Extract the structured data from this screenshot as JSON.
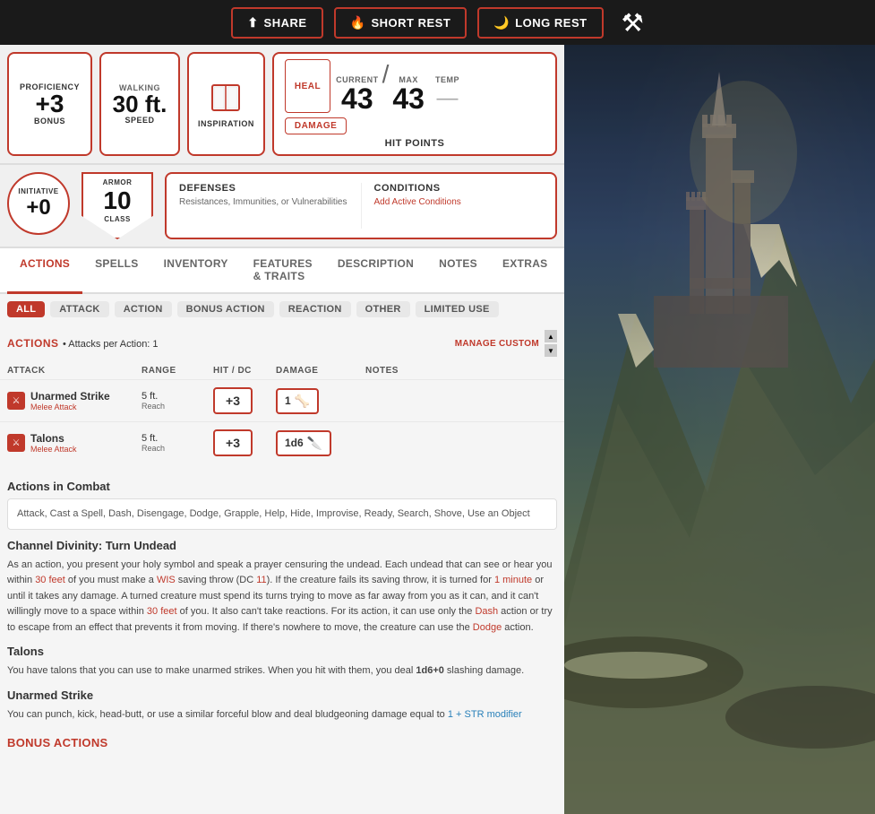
{
  "topBar": {
    "shareLabel": "SHARE",
    "shortRestLabel": "SHORT REST",
    "longRestLabel": "LONG REST"
  },
  "stats": {
    "proficiency": {
      "labelTop": "PROFICIENCY",
      "value": "+3",
      "labelBottom": "BONUS"
    },
    "speed": {
      "labelTop": "WALKING",
      "value": "30 ft.",
      "labelBottom": "SPEED"
    },
    "inspiration": {
      "label": "INSPIRATION"
    },
    "hp": {
      "healLabel": "HEAL",
      "damageLabel": "DAMAGE",
      "currentLabel": "CURRENT",
      "maxLabel": "MAX",
      "tempLabel": "TEMP",
      "currentValue": "43",
      "maxValue": "43",
      "tempValue": "—",
      "hpLabel": "HIT POINTS"
    }
  },
  "defense": {
    "initiative": {
      "label": "INITIATIVE",
      "value": "+0"
    },
    "armor": {
      "labelTop": "ARMOR",
      "value": "10",
      "labelBottom": "CLASS"
    },
    "defenses": {
      "title": "DEFENSES",
      "subtitle": "Resistances, Immunities, or Vulnerabilities"
    },
    "conditions": {
      "title": "CONDITIONS",
      "subtitle": "Add Active Conditions"
    }
  },
  "tabs": {
    "items": [
      "ACTIONS",
      "SPELLS",
      "INVENTORY",
      "FEATURES & TRAITS",
      "DESCRIPTION",
      "NOTES",
      "EXTRAS"
    ],
    "active": "ACTIONS"
  },
  "filters": {
    "items": [
      "ALL",
      "ATTACK",
      "ACTION",
      "BONUS ACTION",
      "REACTION",
      "OTHER",
      "LIMITED USE"
    ],
    "active": "ALL"
  },
  "actionsSection": {
    "title": "ACTIONS",
    "subtitle": "Attacks per Action: 1",
    "manageCustom": "MANAGE CUSTOM",
    "columns": {
      "attack": "ATTACK",
      "range": "RANGE",
      "hitDC": "HIT / DC",
      "damage": "DAMAGE",
      "notes": "NOTES"
    },
    "attacks": [
      {
        "name": "Unarmed Strike",
        "sub": "Melee Attack",
        "range": "5 ft.",
        "rangeSub": "Reach",
        "hit": "+3",
        "damage": "1",
        "damageIcon": "🦾"
      },
      {
        "name": "Talons",
        "sub": "Melee Attack",
        "range": "5 ft.",
        "rangeSub": "Reach",
        "hit": "+3",
        "damage": "1d6",
        "damageIcon": "🔪"
      }
    ]
  },
  "actionsInCombat": {
    "title": "Actions in Combat",
    "text": "Attack, Cast a Spell, Dash, Disengage, Dodge, Grapple, Help, Hide, Improvise, Ready, Search, Shove, Use an Object"
  },
  "channelDivinity": {
    "title": "Channel Divinity: Turn Undead",
    "text": "As an action, you present your holy symbol and speak a prayer censuring the undead. Each undead that can see or hear you within 30 feet of you must make a WIS saving throw (DC 11). If the creature fails its saving throw, it is turned for 1 minute or until it takes any damage. A turned creature must spend its turns trying to move as far away from you as it can, and it can't willingly move to a space within 30 feet of you. It also can't take reactions. For its action, it can use only the Dash action or try to escape from an effect that prevents it from moving. If there's nowhere to move, the creature can use the Dodge action.",
    "highlights": {
      "red": [
        "30 feet",
        "WIS",
        "DC 11",
        "1 minute",
        "30 feet",
        "Dash",
        "Dodge"
      ],
      "blue": []
    }
  },
  "talons": {
    "title": "Talons",
    "text": "You have talons that you can use to make unarmed strikes. When you hit with them, you deal 1d6+0 slashing damage."
  },
  "unarmedStrike": {
    "title": "Unarmed Strike",
    "text": "You can punch, kick, head-butt, or use a similar forceful blow and deal bludgeoning damage equal to 1 + STR modifier"
  },
  "bonusActions": {
    "title": "BONUS ACTIONS"
  }
}
